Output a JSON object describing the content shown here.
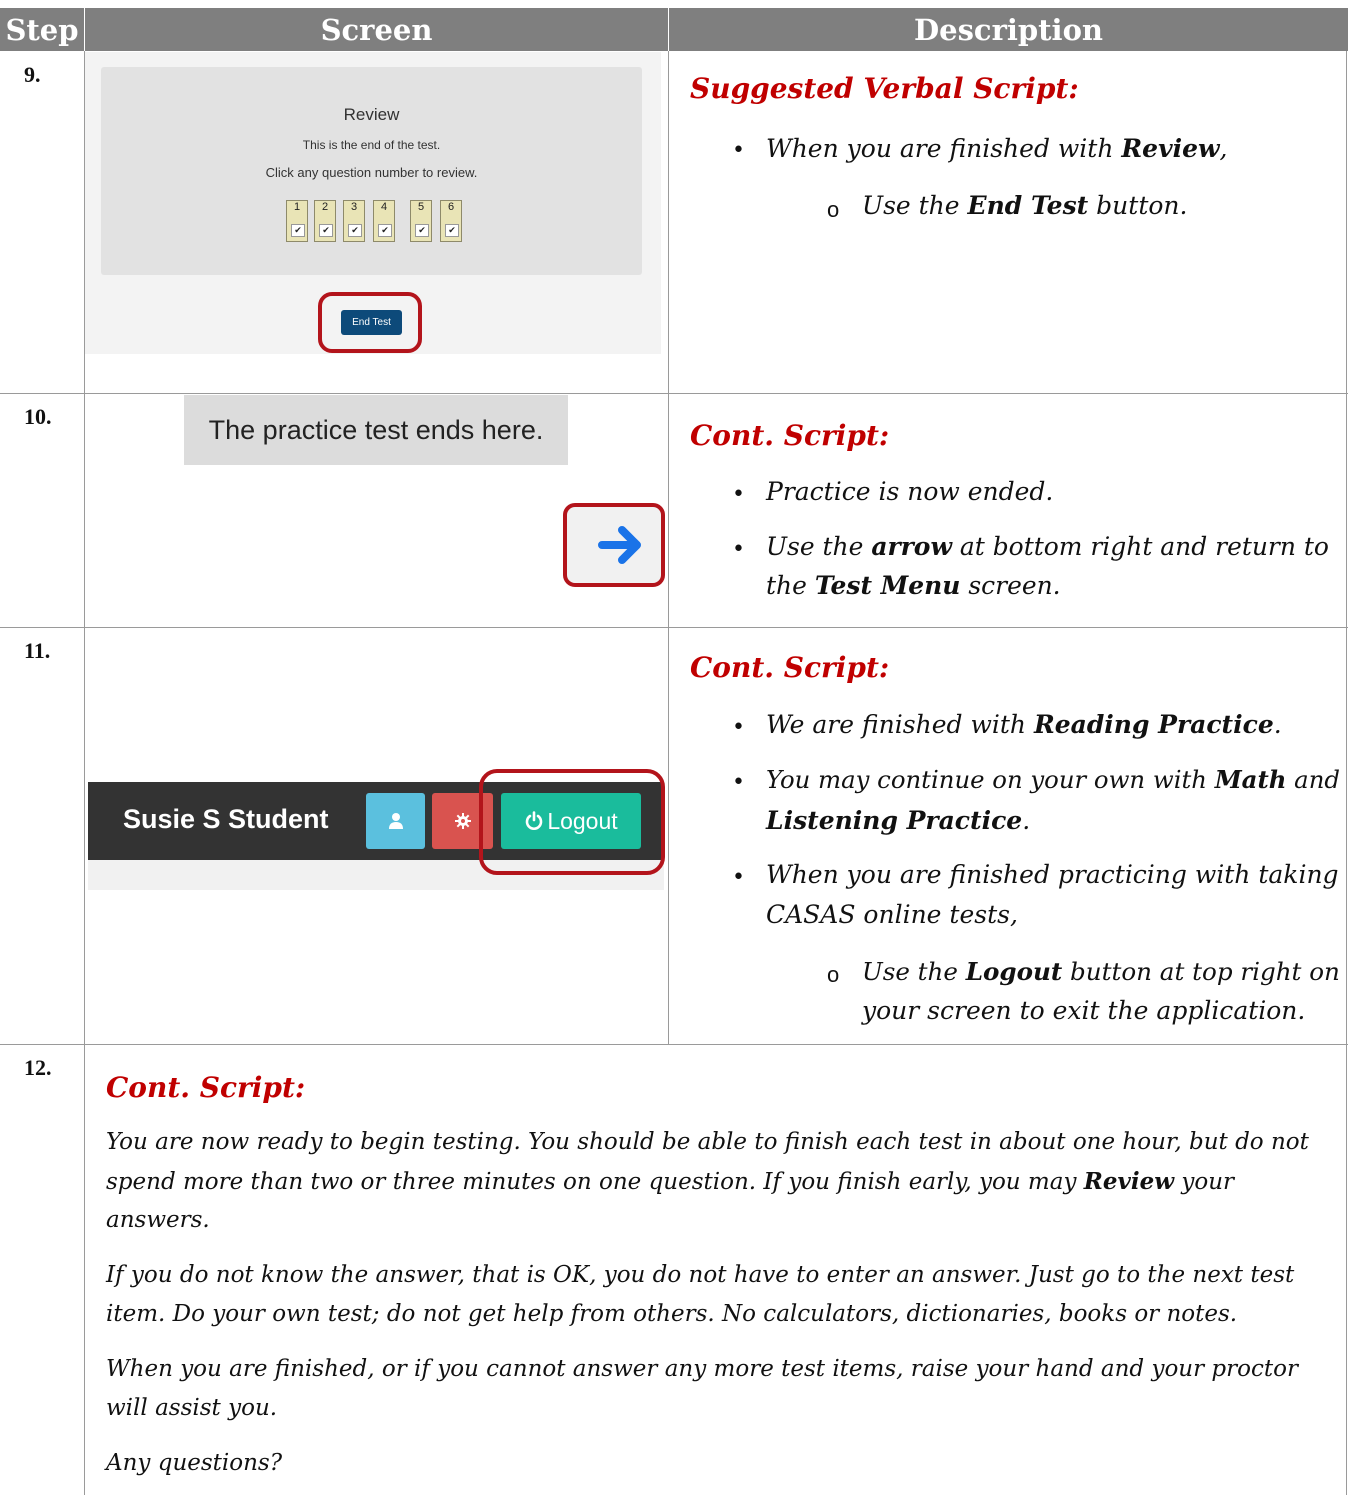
{
  "table": {
    "headers": [
      "Step",
      "Screen",
      "Description"
    ]
  },
  "step9": {
    "number": "9.",
    "screen": {
      "title": "Review",
      "line1": "This is the end of the test.",
      "line2": "Click any question number to review.",
      "questions": [
        "1",
        "2",
        "3",
        "4",
        "5",
        "6"
      ],
      "check_mark": "✔",
      "end_button": "End Test"
    },
    "desc": {
      "heading": "Suggested Verbal Script:",
      "b1_pre": "When you are finished with ",
      "b1_bold": "Review",
      "b1_post": ",",
      "sub_pre": "Use the ",
      "sub_bold": "End Test",
      "sub_post": " button."
    }
  },
  "step10": {
    "number": "10.",
    "screen": {
      "banner": "The practice test ends here.",
      "arrow_icon": "arrow-right-icon"
    },
    "desc": {
      "heading": "Cont. Script:",
      "b1": "Practice is now ended.",
      "b2_pre": "Use the ",
      "b2_bold": "arrow",
      "b2_mid": " at bottom right and return to the ",
      "b2_bold2": "Test Menu",
      "b2_post": " screen."
    }
  },
  "step11": {
    "number": "11.",
    "screen": {
      "user_name": "Susie S Student",
      "user_icon": "user-icon",
      "settings_icon": "gear-icon",
      "logout_icon": "power-icon",
      "logout_label": "Logout",
      "colors": {
        "navbar": "#333333",
        "user_btn": "#5bc0de",
        "settings_btn": "#d9534f",
        "logout_btn": "#1abc9c"
      }
    },
    "desc": {
      "heading": "Cont. Script:",
      "b1_pre": "We are finished with ",
      "b1_bold": "Reading Practice",
      "b1_post": ".",
      "b2_l1_pre": "You may continue on your own with ",
      "b2_l1_bold": "Math",
      "b2_l1_post": " and",
      "b2_l2_bold": "Listening Practice",
      "b2_l2_post": ".",
      "b3_l1": "When you are finished practicing with taking",
      "b3_l2": "CASAS online tests,",
      "sub_l1_pre": "Use the ",
      "sub_l1_bold": "Logout",
      "sub_l1_post": " button at top right on",
      "sub_l2": "your screen to exit the application."
    }
  },
  "step12": {
    "number": "12.",
    "heading": "Cont. Script:",
    "p1_l1": "You are now ready to begin testing. You should be able to finish each test in about one hour, but do not",
    "p1_l2_pre": "spend more than two or three minutes on one question. If you finish early, you may ",
    "p1_l2_bold": "Review",
    "p1_l2_post": " your",
    "p1_l3": "answers.",
    "p2_l1": "If you do not know the answer, that is OK, you do not have to enter an answer. Just go to the next test",
    "p2_l2": "item. Do your own test; do not get help from others. No calculators, dictionaries, books or notes.",
    "p3_l1": "When you are finished, or if you cannot answer any more test items, raise your hand and your proctor",
    "p3_l2": "will assist you.",
    "p4": "Any questions?"
  },
  "bullet_glyph": "•",
  "sub_bullet_glyph": "o"
}
